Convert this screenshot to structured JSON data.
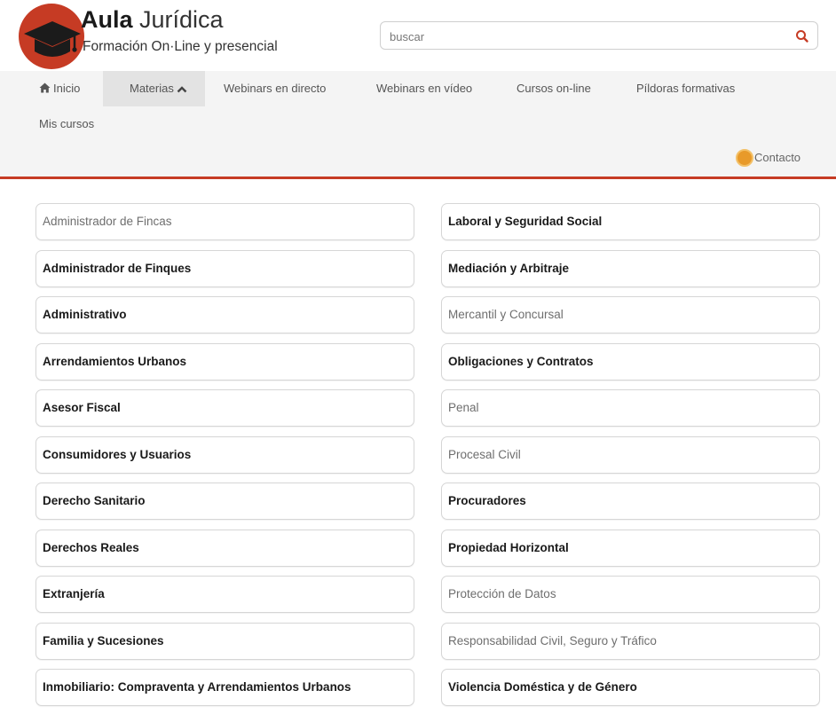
{
  "brand": {
    "title_bold": "Aula",
    "title_light": "Jurídica",
    "subtitle": "Formación On·Line y presencial",
    "logo_icon": "graduation-cap-icon",
    "logo_color": "#c63b24"
  },
  "search": {
    "placeholder": "buscar",
    "icon": "search-icon"
  },
  "nav": {
    "items": [
      {
        "label": "Inicio",
        "icon": "home-icon"
      },
      {
        "label": "Materias",
        "icon": "chevron-up-icon",
        "active": true
      },
      {
        "label": "Webinars en directo"
      },
      {
        "label": "Webinars en vídeo"
      },
      {
        "label": "Cursos on-line"
      },
      {
        "label": "Píldoras formativas"
      },
      {
        "label": "Mis cursos"
      }
    ],
    "contact_label": "Contacto",
    "contact_icon": "chat-bubble-icon",
    "accent_line_color": "#c63b24"
  },
  "materias": {
    "left": [
      {
        "label": "Administrador de Fincas",
        "style": "muted"
      },
      {
        "label": "Administrador de Finques",
        "style": "dark"
      },
      {
        "label": "Administrativo",
        "style": "dark"
      },
      {
        "label": "Arrendamientos Urbanos",
        "style": "dark"
      },
      {
        "label": "Asesor Fiscal",
        "style": "dark"
      },
      {
        "label": "Consumidores y Usuarios",
        "style": "dark"
      },
      {
        "label": "Derecho Sanitario",
        "style": "dark"
      },
      {
        "label": "Derechos Reales",
        "style": "dark"
      },
      {
        "label": "Extranjería",
        "style": "dark"
      },
      {
        "label": "Familia y Sucesiones",
        "style": "dark"
      },
      {
        "label": "Inmobiliario: Compraventa y Arrendamientos Urbanos",
        "style": "dark"
      }
    ],
    "right": [
      {
        "label": "Laboral y Seguridad Social",
        "style": "dark"
      },
      {
        "label": "Mediación y Arbitraje",
        "style": "dark"
      },
      {
        "label": "Mercantil y Concursal",
        "style": "muted"
      },
      {
        "label": "Obligaciones y Contratos",
        "style": "dark"
      },
      {
        "label": "Penal",
        "style": "muted"
      },
      {
        "label": "Procesal Civil",
        "style": "muted"
      },
      {
        "label": "Procuradores",
        "style": "dark"
      },
      {
        "label": "Propiedad Horizontal",
        "style": "dark"
      },
      {
        "label": "Protección de Datos",
        "style": "muted"
      },
      {
        "label": "Responsabilidad Civil, Seguro y Tráfico",
        "style": "muted"
      },
      {
        "label": "Violencia Doméstica y de Género",
        "style": "dark"
      }
    ]
  }
}
